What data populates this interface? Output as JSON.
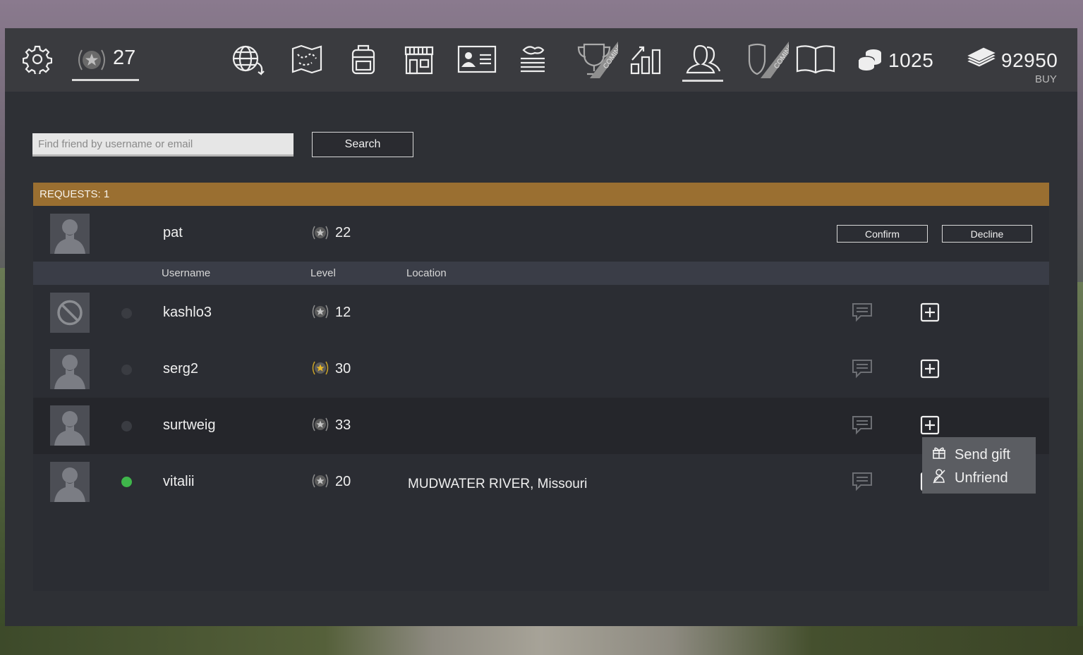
{
  "topbar": {
    "player_level": "27",
    "coins": "1025",
    "cash": "92950",
    "buy_label": "BUY",
    "coming_soon_label": "COMING",
    "icons": [
      "settings-icon",
      "level-star-icon",
      "world-map-icon",
      "map-icon",
      "backpack-icon",
      "shop-icon",
      "profile-card-icon",
      "news-icon",
      "trophy-icon",
      "stats-icon",
      "friends-icon",
      "clan-icon",
      "book-icon",
      "coins-icon",
      "cash-icon"
    ]
  },
  "search": {
    "placeholder": "Find friend by username or email",
    "value": "",
    "button_label": "Search"
  },
  "requests": {
    "header": "REQUESTS: 1",
    "items": [
      {
        "username": "pat",
        "level": "22",
        "confirm_label": "Confirm",
        "decline_label": "Decline"
      }
    ]
  },
  "columns": {
    "username": "Username",
    "level": "Level",
    "location": "Location"
  },
  "friends": [
    {
      "username": "kashlo3",
      "level": "12",
      "location": "",
      "online": false,
      "avatar": "blocked-icon"
    },
    {
      "username": "serg2",
      "level": "30",
      "location": "",
      "online": false,
      "avatar": "user-silhouette",
      "gold_badge": true
    },
    {
      "username": "surtweig",
      "level": "33",
      "location": "",
      "online": false,
      "avatar": "user-silhouette",
      "highlighted": true
    },
    {
      "username": "vitalii",
      "level": "20",
      "location": "MUDWATER RIVER, Missouri",
      "online": true,
      "avatar": "user-silhouette"
    }
  ],
  "context_menu": {
    "send_gift_label": "Send gift",
    "unfriend_label": "Unfriend"
  },
  "colors": {
    "requests_bar": "#9a6f31",
    "online": "#3fb64b",
    "offline": "#3a3c42",
    "panel": "#2b2d33"
  }
}
